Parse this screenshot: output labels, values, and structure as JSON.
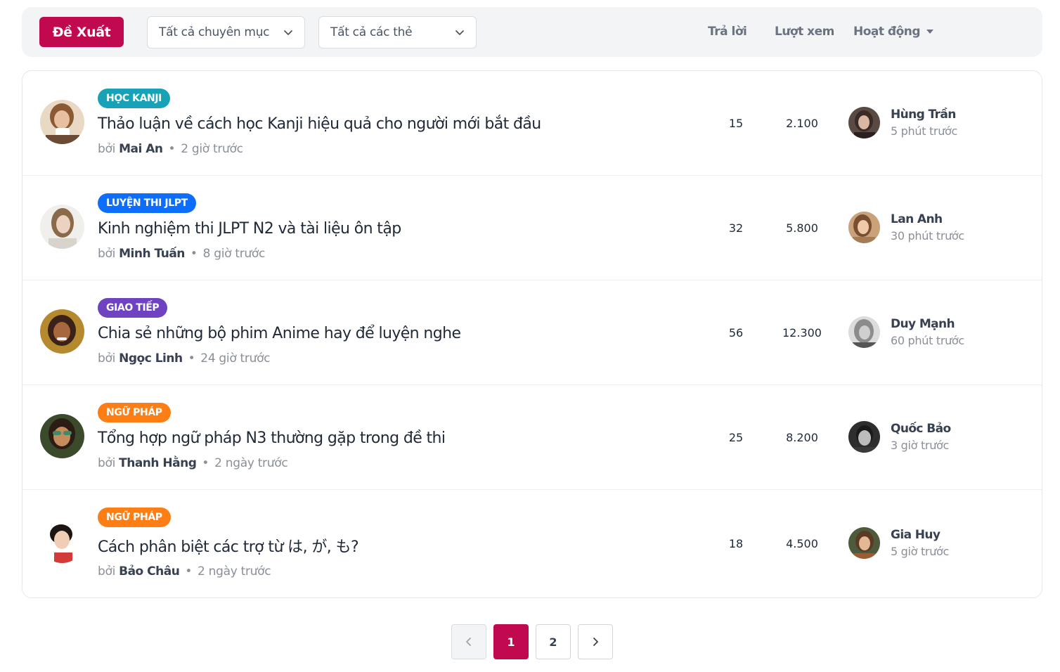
{
  "toolbar": {
    "propose_label": "Đề Xuất",
    "category_select": "Tất cả chuyên mục",
    "tag_select": "Tất cả các thẻ",
    "col_replies": "Trả lời",
    "col_views": "Lượt xem",
    "col_activity": "Hoạt động"
  },
  "by_label": "bởi",
  "topics": [
    {
      "tag": "HỌC KANJI",
      "tag_color": "#17a2b8",
      "title": "Thảo luận về cách học Kanji hiệu quả cho người mới bắt đầu",
      "author": "Mai An",
      "posted": "2 giờ trước",
      "replies": "15",
      "views": "2.100",
      "last_user": "Hùng Trần",
      "last_time": "5 phút trước"
    },
    {
      "tag": "LUYỆN THI JLPT",
      "tag_color": "#0d6efd",
      "title": "Kinh nghiệm thi JLPT N2 và tài liệu ôn tập",
      "author": "Minh Tuấn",
      "posted": "8 giờ trước",
      "replies": "32",
      "views": "5.800",
      "last_user": "Lan Anh",
      "last_time": "30 phút trước"
    },
    {
      "tag": "GIAO TIẾP",
      "tag_color": "#6f42c1",
      "title": "Chia sẻ những bộ phim Anime hay để luyện nghe",
      "author": "Ngọc Linh",
      "posted": "24 giờ trước",
      "replies": "56",
      "views": "12.300",
      "last_user": "Duy Mạnh",
      "last_time": "60 phút trước"
    },
    {
      "tag": "NGỮ PHÁP",
      "tag_color": "#fd7e14",
      "title": "Tổng hợp ngữ pháp N3 thường gặp trong đề thi",
      "author": "Thanh Hằng",
      "posted": "2 ngày trước",
      "replies": "25",
      "views": "8.200",
      "last_user": "Quốc Bảo",
      "last_time": "3 giờ trước"
    },
    {
      "tag": "NGỮ PHÁP",
      "tag_color": "#fd7e14",
      "title": "Cách phân biệt các trợ từ は, が, も?",
      "author": "Bảo Châu",
      "posted": "2 ngày trước",
      "replies": "18",
      "views": "4.500",
      "last_user": "Gia Huy",
      "last_time": "5 giờ trước"
    }
  ],
  "pagination": {
    "pages": [
      "1",
      "2"
    ],
    "current": "1"
  },
  "colors": {
    "brand": "#c0094e"
  }
}
